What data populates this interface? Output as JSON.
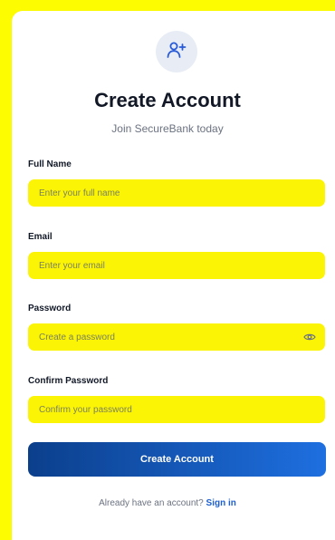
{
  "header": {
    "icon": "user-plus-icon",
    "title": "Create Account",
    "subtitle": "Join SecureBank today"
  },
  "form": {
    "full_name": {
      "label": "Full Name",
      "placeholder": "Enter your full name",
      "value": ""
    },
    "email": {
      "label": "Email",
      "placeholder": "Enter your email",
      "value": ""
    },
    "password": {
      "label": "Password",
      "placeholder": "Create a password",
      "value": "",
      "toggle_icon": "eye-icon"
    },
    "confirm_password": {
      "label": "Confirm Password",
      "placeholder": "Confirm your password",
      "value": ""
    },
    "submit_label": "Create Account"
  },
  "footer": {
    "prompt": "Already have an account?",
    "link_label": "Sign in"
  },
  "colors": {
    "background": "#fdfc00",
    "field_fill": "#fbf405",
    "primary_start": "#0b3f8c",
    "primary_end": "#1e6fe0",
    "link": "#1d5fd1"
  }
}
